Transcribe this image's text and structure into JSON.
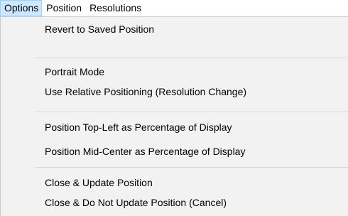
{
  "menubar": {
    "items": [
      {
        "label": "Options"
      },
      {
        "label": "Position"
      },
      {
        "label": "Resolutions"
      }
    ]
  },
  "dropdown": {
    "groups": [
      {
        "items": [
          "Revert to Saved Position"
        ]
      },
      {
        "items": [
          "Portrait Mode",
          "Use Relative Positioning (Resolution Change)"
        ]
      },
      {
        "items": [
          "Position Top-Left as Percentage of Display",
          "Position Mid-Center as Percentage of Display"
        ]
      },
      {
        "items": [
          "Close & Update Position",
          "Close & Do Not Update Position (Cancel)"
        ]
      }
    ]
  },
  "colors": {
    "menu_background": "#f2f2f2",
    "active_highlight": "#cce8ff",
    "active_border": "#99d1ff",
    "separator": "#d7d7d7"
  }
}
